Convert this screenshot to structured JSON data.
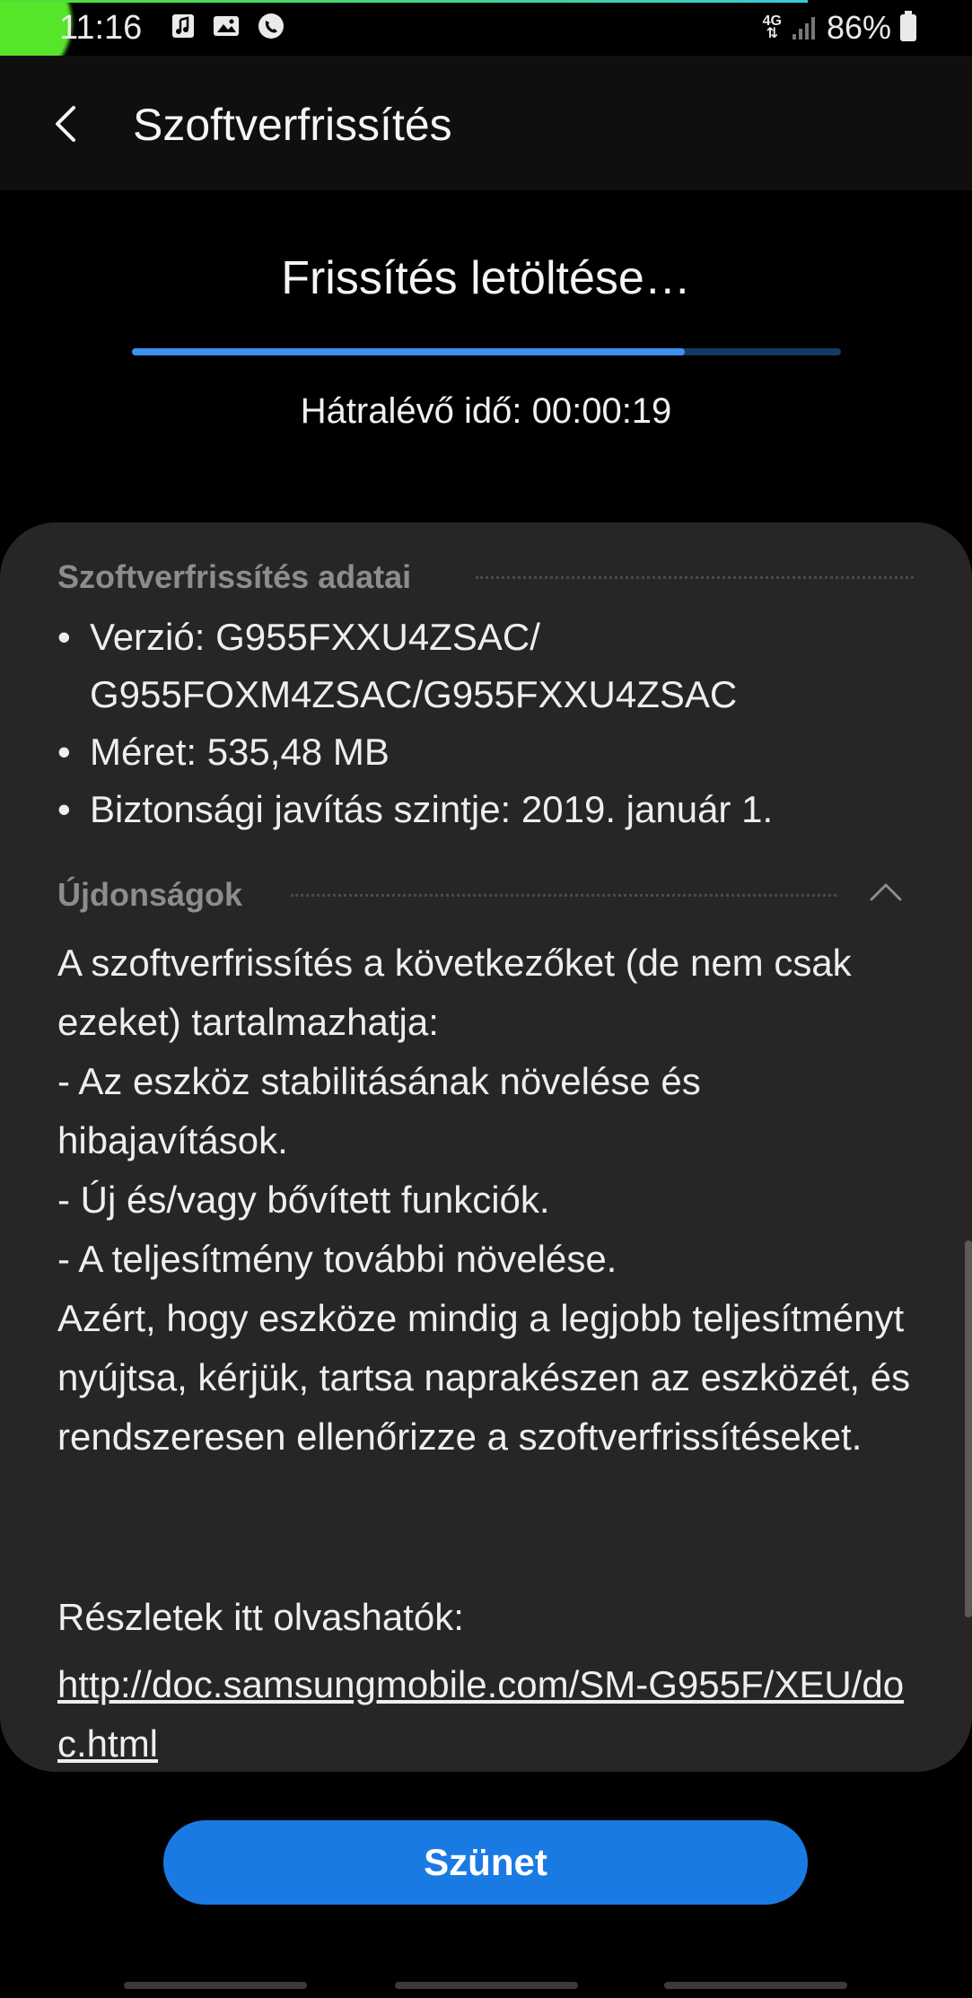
{
  "status_bar": {
    "time": "11:16",
    "network": "4G",
    "battery": "86%",
    "icons": [
      "music-note-icon",
      "image-icon",
      "call-icon",
      "signal-icon",
      "battery-icon"
    ]
  },
  "app_bar": {
    "title": "Szoftverfrissítés",
    "back_icon": "back-arrow-icon"
  },
  "download": {
    "title": "Frissítés letöltése…",
    "progress_percent": 78,
    "remaining_text": "Hátralévő idő: 00:00:19"
  },
  "details": {
    "header": "Szoftverfrissítés adatai",
    "items": [
      "Verzió: G955FXXU4ZSAC/ G955FOXM4ZSAC/G955FXXU4ZSAC",
      "Méret: 535,48 MB",
      "Biztonsági javítás szintje: 2019. január 1."
    ]
  },
  "news": {
    "header": "Újdonságok",
    "collapse_icon": "chevron-up-icon",
    "body": "A szoftverfrissítés a következőket (de nem csak ezeket) tartalmazhatja:\n - Az eszköz stabilitásának növelése és hibajavítások.\n - Új és/vagy bővített funkciók.\n - A teljesítmény további növelése.\nAzért, hogy eszköze mindig a legjobb teljesítményt nyújtsa, kérjük, tartsa naprakészen az eszközét, és rendszeresen ellenőrizze a szoftverfrissítéseket.",
    "details_label": "Részletek itt olvashatók:",
    "details_link": "http://doc.samsungmobile.com/SM-G955F/XEU/doc.html"
  },
  "actions": {
    "pause_label": "Szünet"
  },
  "colors": {
    "accent": "#1a7ae3",
    "progress": "#3d8ff0",
    "card": "#262626",
    "background": "#000000"
  }
}
